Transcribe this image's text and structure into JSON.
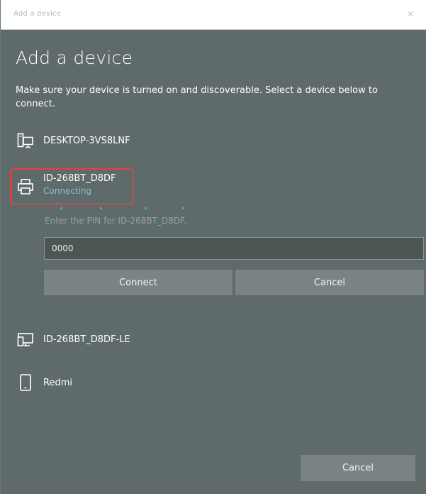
{
  "window": {
    "title": "Add a device",
    "close_icon": "close-icon"
  },
  "heading": "Add a device",
  "instructions": "Make sure your device is turned on and discoverable. Select a device below to connect.",
  "devices": [
    {
      "name": "DESKTOP-3VS8LNF",
      "icon": "computer-icon"
    },
    {
      "name": "ID-268BT_D8DF",
      "icon": "printer-icon",
      "status": "Connecting"
    },
    {
      "name": "ID-268BT_D8DF-LE",
      "icon": "display-icon"
    },
    {
      "name": "Redmi",
      "icon": "phone-icon"
    }
  ],
  "pairing": {
    "prompt": "Enter the PIN for ID-268BT_D8DF.",
    "pin_value": "0000",
    "connect_label": "Connect",
    "cancel_label": "Cancel"
  },
  "footer": {
    "cancel_label": "Cancel"
  },
  "colors": {
    "window_bg": "#5f6a6a",
    "button_bg": "#7b8484",
    "highlight_border": "#e0423f",
    "status_text": "#7fc1d0"
  }
}
